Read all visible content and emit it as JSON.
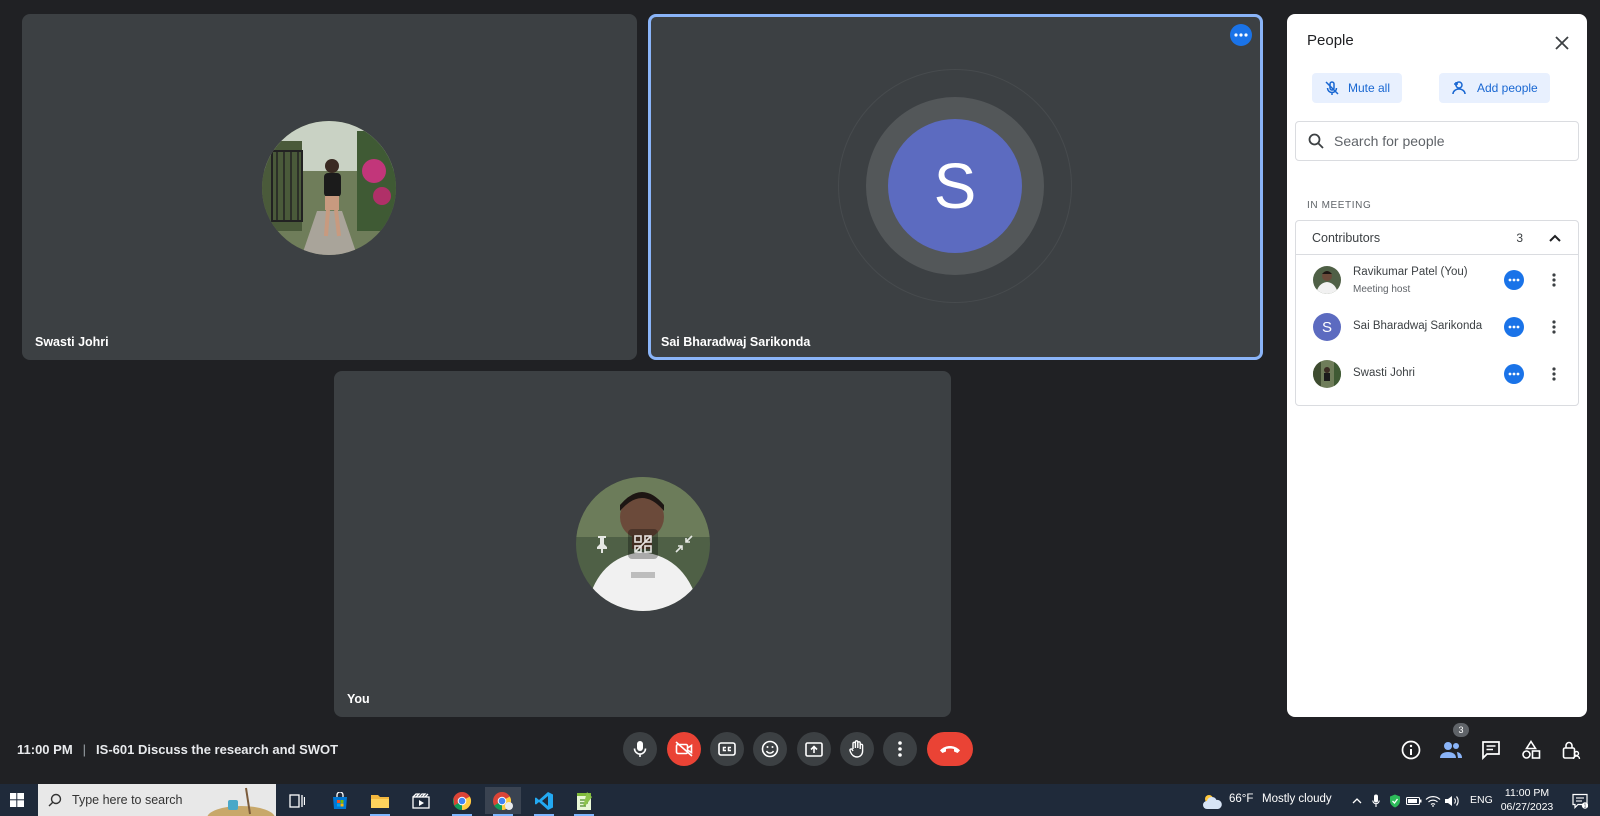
{
  "tiles": {
    "swasti": {
      "name": "Swasti Johri"
    },
    "sai": {
      "name": "Sai Bharadwaj Sarikonda",
      "initial": "S"
    },
    "you": {
      "name": "You"
    }
  },
  "panel": {
    "title": "People",
    "mute_all": "Mute all",
    "add_people": "Add people",
    "search_placeholder": "Search for people",
    "section_label": "IN MEETING",
    "group": {
      "label": "Contributors",
      "count": "3"
    },
    "people": [
      {
        "name": "Ravikumar Patel (You)",
        "subtitle": "Meeting host"
      },
      {
        "name": "Sai Bharadwaj Sarikonda",
        "initial": "S"
      },
      {
        "name": "Swasti Johri"
      }
    ]
  },
  "bottom": {
    "time": "11:00 PM",
    "separator": "|",
    "meeting_title": "IS-601 Discuss the research and SWOT",
    "people_badge": "3"
  },
  "taskbar": {
    "search_placeholder": "Type here to search",
    "weather_temp": "66°F",
    "weather_desc": "Mostly cloudy",
    "language": "ENG",
    "clock_time": "11:00 PM",
    "clock_date": "06/27/2023"
  },
  "colors": {
    "background": "#202124",
    "tile": "#3c4043",
    "active_outline": "#8ab4f8",
    "accent_blue": "#1a73e8",
    "end_call_red": "#ea4335",
    "avatar_indigo": "#5c6bc0"
  }
}
